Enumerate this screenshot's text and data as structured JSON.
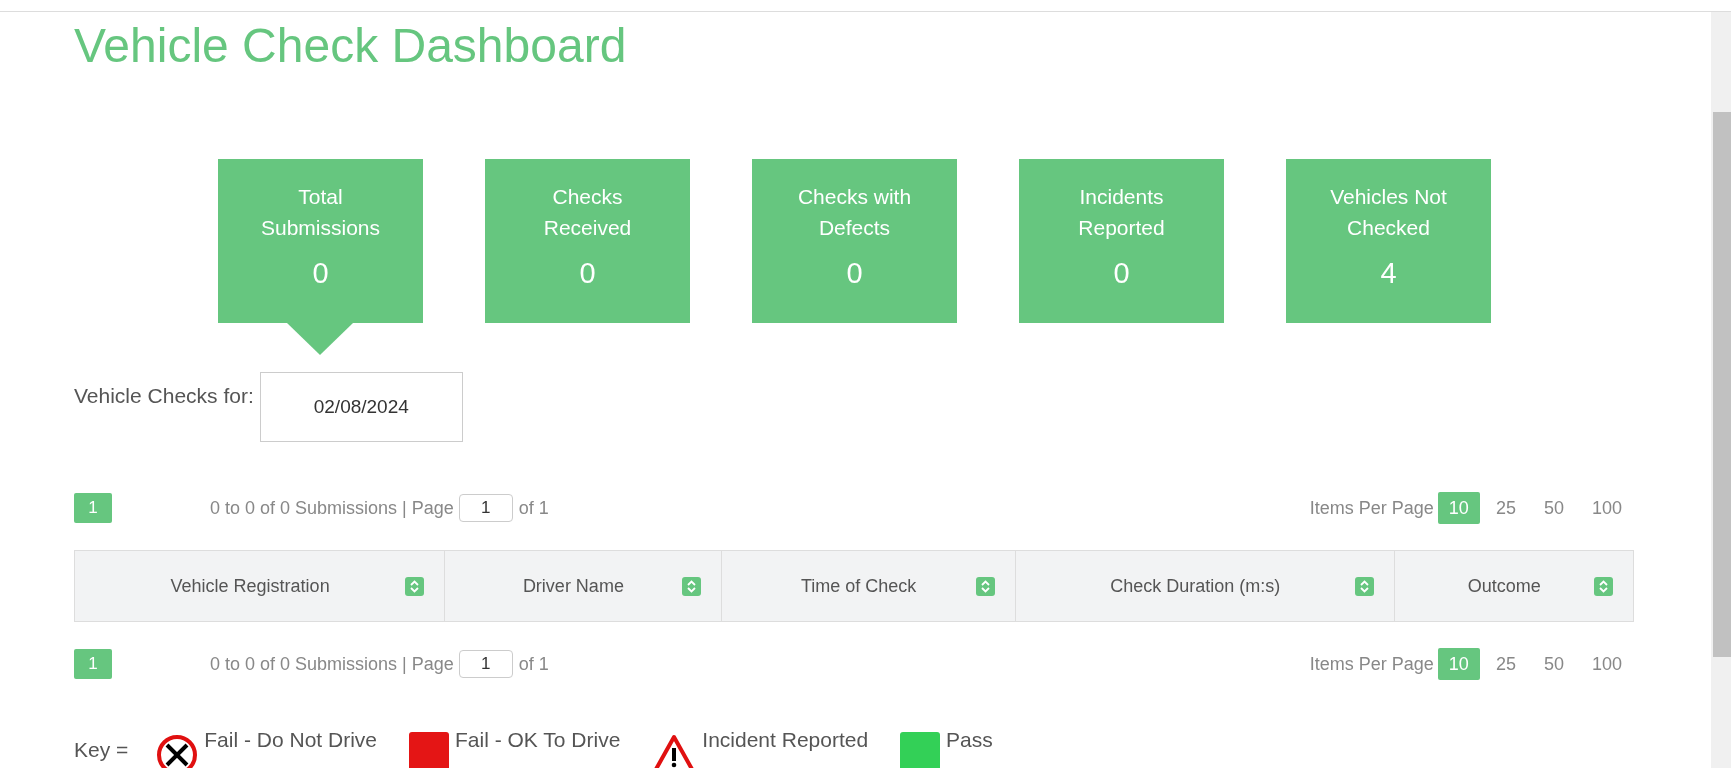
{
  "title": "Vehicle Check Dashboard",
  "cards": [
    {
      "label": "Total Submissions",
      "value": "0",
      "selected": true
    },
    {
      "label": "Checks Received",
      "value": "0",
      "selected": false
    },
    {
      "label": "Checks with Defects",
      "value": "0",
      "selected": false
    },
    {
      "label": "Incidents Reported",
      "value": "0",
      "selected": false
    },
    {
      "label": "Vehicles Not Checked",
      "value": "4",
      "selected": false
    }
  ],
  "date_filter": {
    "label": "Vehicle Checks for:",
    "value": "02/08/2024"
  },
  "pagination_top": {
    "page_button": "1",
    "summary": "0 to 0 of 0 Submissions | Page",
    "page": "1",
    "of": "of 1",
    "items_label": "Items Per Page",
    "options": [
      {
        "label": "10",
        "selected": true
      },
      {
        "label": "25",
        "selected": false
      },
      {
        "label": "50",
        "selected": false
      },
      {
        "label": "100",
        "selected": false
      }
    ]
  },
  "table": {
    "columns": [
      "Vehicle Registration",
      "Driver Name",
      "Time of Check",
      "Check Duration (m:s)",
      "Outcome"
    ]
  },
  "pagination_bottom": {
    "page_button": "1",
    "summary": "0 to 0 of 0 Submissions | Page",
    "page": "1",
    "of": "of 1",
    "items_label": "Items Per Page",
    "options": [
      {
        "label": "10",
        "selected": true
      },
      {
        "label": "25",
        "selected": false
      },
      {
        "label": "50",
        "selected": false
      },
      {
        "label": "100",
        "selected": false
      }
    ]
  },
  "key": {
    "label": "Key =",
    "items": [
      {
        "kind": "no-drive",
        "label": "Fail - Do Not Drive"
      },
      {
        "kind": "fail",
        "label": "Fail - OK To Drive"
      },
      {
        "kind": "incident",
        "label": "Incident Reported"
      },
      {
        "kind": "pass",
        "label": "Pass"
      }
    ]
  }
}
